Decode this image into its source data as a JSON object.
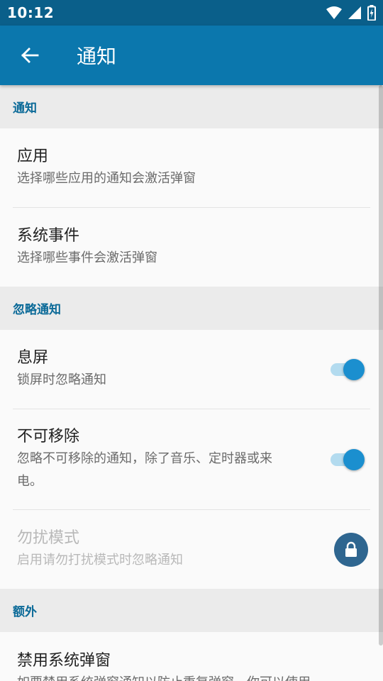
{
  "status_bar": {
    "time": "10:12"
  },
  "app_bar": {
    "title": "通知"
  },
  "sections": [
    {
      "header": "通知",
      "items": [
        {
          "title": "应用",
          "summary": "选择哪些应用的通知会激活弹窗"
        },
        {
          "title": "系统事件",
          "summary": "选择哪些事件会激活弹窗"
        }
      ]
    },
    {
      "header": "忽略通知",
      "items": [
        {
          "title": "息屏",
          "summary": "锁屏时忽略通知",
          "control": "switch",
          "checked": true
        },
        {
          "title": "不可移除",
          "summary": "忽略不可移除的通知，除了音乐、定时器或来电。",
          "control": "switch",
          "checked": true
        },
        {
          "title": "勿扰模式",
          "summary": "启用请勿打扰模式时忽略通知",
          "control": "lock",
          "disabled": true
        }
      ]
    },
    {
      "header": "额外",
      "items": [
        {
          "title": "禁用系统弹窗",
          "summary": "如要禁用系统弹窗通知以防止重复弹窗，你可以使用"
        }
      ]
    }
  ],
  "colors": {
    "status_bar": "#0a5f8a",
    "app_bar": "#0b77ad",
    "accent": "#1b8fcf",
    "section_text": "#0b6a98"
  }
}
